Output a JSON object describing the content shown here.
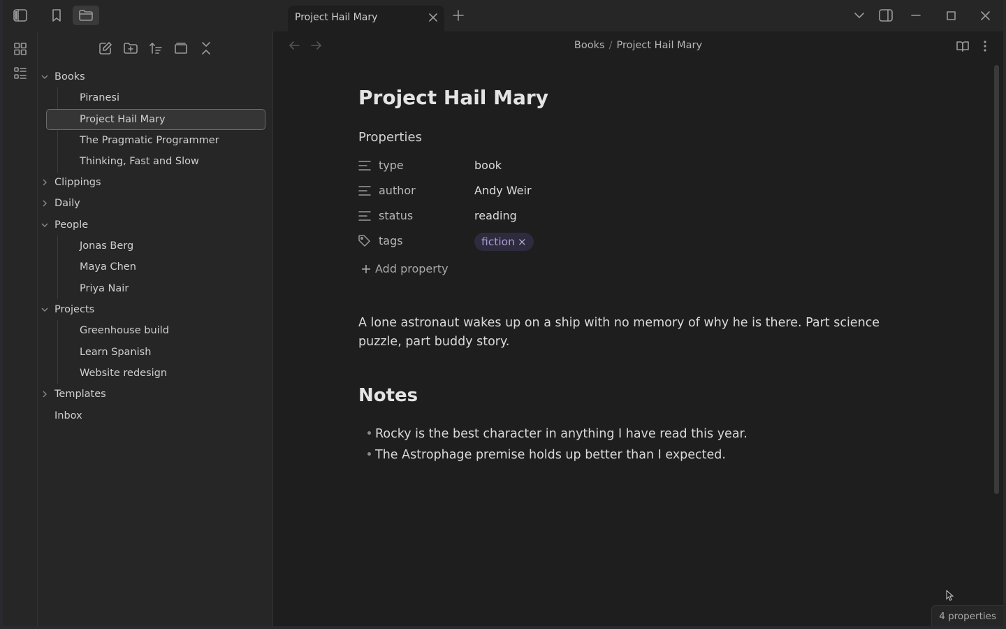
{
  "tab": {
    "title": "Project Hail Mary"
  },
  "breadcrumb": {
    "parent": "Books",
    "separator": "/",
    "current": "Project Hail Mary"
  },
  "sidebar": {
    "tree": [
      {
        "label": "Books",
        "kind": "folder",
        "expanded": true
      },
      {
        "label": "Piranesi",
        "kind": "file"
      },
      {
        "label": "Project Hail Mary",
        "kind": "file",
        "selected": true
      },
      {
        "label": "The Pragmatic Programmer",
        "kind": "file"
      },
      {
        "label": "Thinking, Fast and Slow",
        "kind": "file"
      },
      {
        "label": "Clippings",
        "kind": "folder",
        "expanded": false
      },
      {
        "label": "Daily",
        "kind": "folder",
        "expanded": false
      },
      {
        "label": "People",
        "kind": "folder",
        "expanded": true
      },
      {
        "label": "Jonas Berg",
        "kind": "file"
      },
      {
        "label": "Maya Chen",
        "kind": "file"
      },
      {
        "label": "Priya Nair",
        "kind": "file"
      },
      {
        "label": "Projects",
        "kind": "folder",
        "expanded": true
      },
      {
        "label": "Greenhouse build",
        "kind": "file"
      },
      {
        "label": "Learn Spanish",
        "kind": "file"
      },
      {
        "label": "Website redesign",
        "kind": "file"
      },
      {
        "label": "Templates",
        "kind": "folder",
        "expanded": false
      },
      {
        "label": "Inbox",
        "kind": "file-root"
      }
    ]
  },
  "note": {
    "title": "Project Hail Mary",
    "properties_heading": "Properties",
    "properties": [
      {
        "key": "type",
        "value": "book",
        "icon": "text-lines-icon"
      },
      {
        "key": "author",
        "value": "Andy Weir",
        "icon": "text-lines-icon"
      },
      {
        "key": "status",
        "value": "reading",
        "icon": "text-lines-icon"
      },
      {
        "key": "tags",
        "tag": "fiction",
        "tag_remove": "×",
        "icon": "tags-icon"
      }
    ],
    "add_property": "Add property",
    "paragraph": "A lone astronaut wakes up on a ship with no memory of why he is there. Part science puzzle, part buddy story.",
    "notes_heading": "Notes",
    "bullets": [
      "Rocky is the best character in anything I have read this year.",
      "The Astrophage premise holds up better than I expected."
    ]
  },
  "status": {
    "properties_count": "4 properties"
  },
  "colors": {
    "accent_tag_bg": "#2e2b3e",
    "accent_tag_text": "#a99ccf",
    "background": "#1e1e1e",
    "sidebar": "#262626"
  }
}
